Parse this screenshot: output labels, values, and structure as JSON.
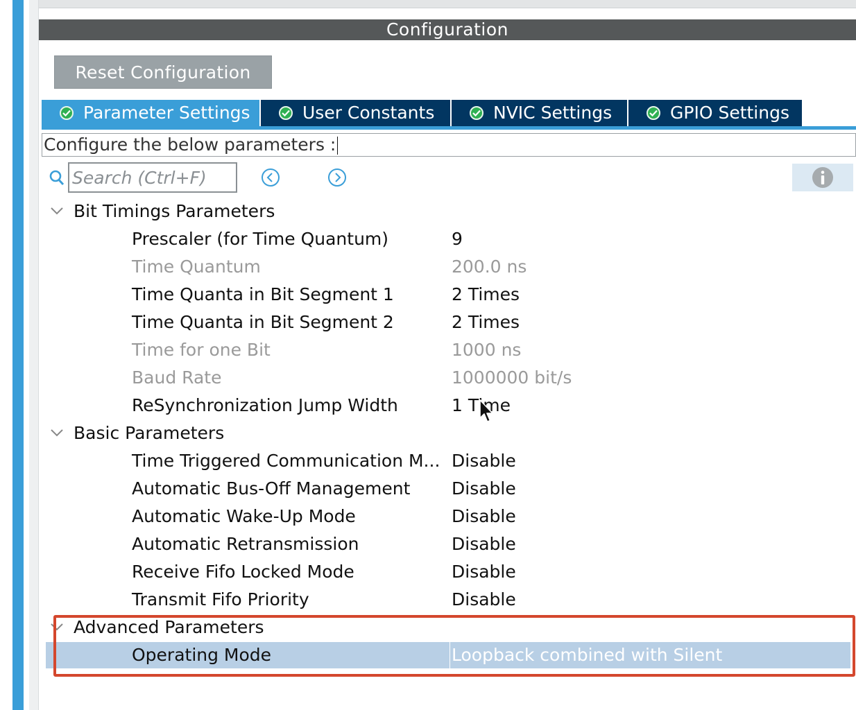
{
  "header": {
    "title": "Configuration"
  },
  "toolbar": {
    "reset_label": "Reset Configuration"
  },
  "tabs": [
    {
      "label": "Parameter Settings",
      "active": true
    },
    {
      "label": "User Constants",
      "active": false
    },
    {
      "label": "NVIC Settings",
      "active": false
    },
    {
      "label": "GPIO Settings",
      "active": false
    }
  ],
  "description": "Configure the below parameters :",
  "search": {
    "placeholder": "Search (Ctrl+F)",
    "value": ""
  },
  "sections": {
    "bit_timings": {
      "label": "Bit Timings Parameters",
      "rows": [
        {
          "name": "Prescaler (for Time Quantum)",
          "value": "9"
        },
        {
          "name": "Time Quantum",
          "value": "200.0 ns"
        },
        {
          "name": "Time Quanta in Bit Segment 1",
          "value": "2 Times"
        },
        {
          "name": "Time Quanta in Bit Segment 2",
          "value": "2 Times"
        },
        {
          "name": "Time for one Bit",
          "value": "1000 ns"
        },
        {
          "name": "Baud Rate",
          "value": "1000000 bit/s"
        },
        {
          "name": "ReSynchronization Jump Width",
          "value": "1 Time"
        }
      ]
    },
    "basic": {
      "label": "Basic Parameters",
      "rows": [
        {
          "name": "Time Triggered Communication M...",
          "value": "Disable"
        },
        {
          "name": "Automatic Bus-Off Management",
          "value": "Disable"
        },
        {
          "name": "Automatic Wake-Up Mode",
          "value": "Disable"
        },
        {
          "name": "Automatic Retransmission",
          "value": "Disable"
        },
        {
          "name": "Receive Fifo Locked Mode",
          "value": "Disable"
        },
        {
          "name": "Transmit Fifo Priority",
          "value": "Disable"
        }
      ]
    },
    "advanced": {
      "label": "Advanced Parameters",
      "rows": [
        {
          "name": "Operating Mode",
          "value": "Loopback combined with Silent"
        }
      ]
    }
  },
  "colors": {
    "accent": "#3a9ed8",
    "tab_bg": "#023661",
    "check": "#2fb052",
    "selected_row": "#b8cfe5",
    "highlight": "#d4472d",
    "header_bg": "#555859"
  }
}
